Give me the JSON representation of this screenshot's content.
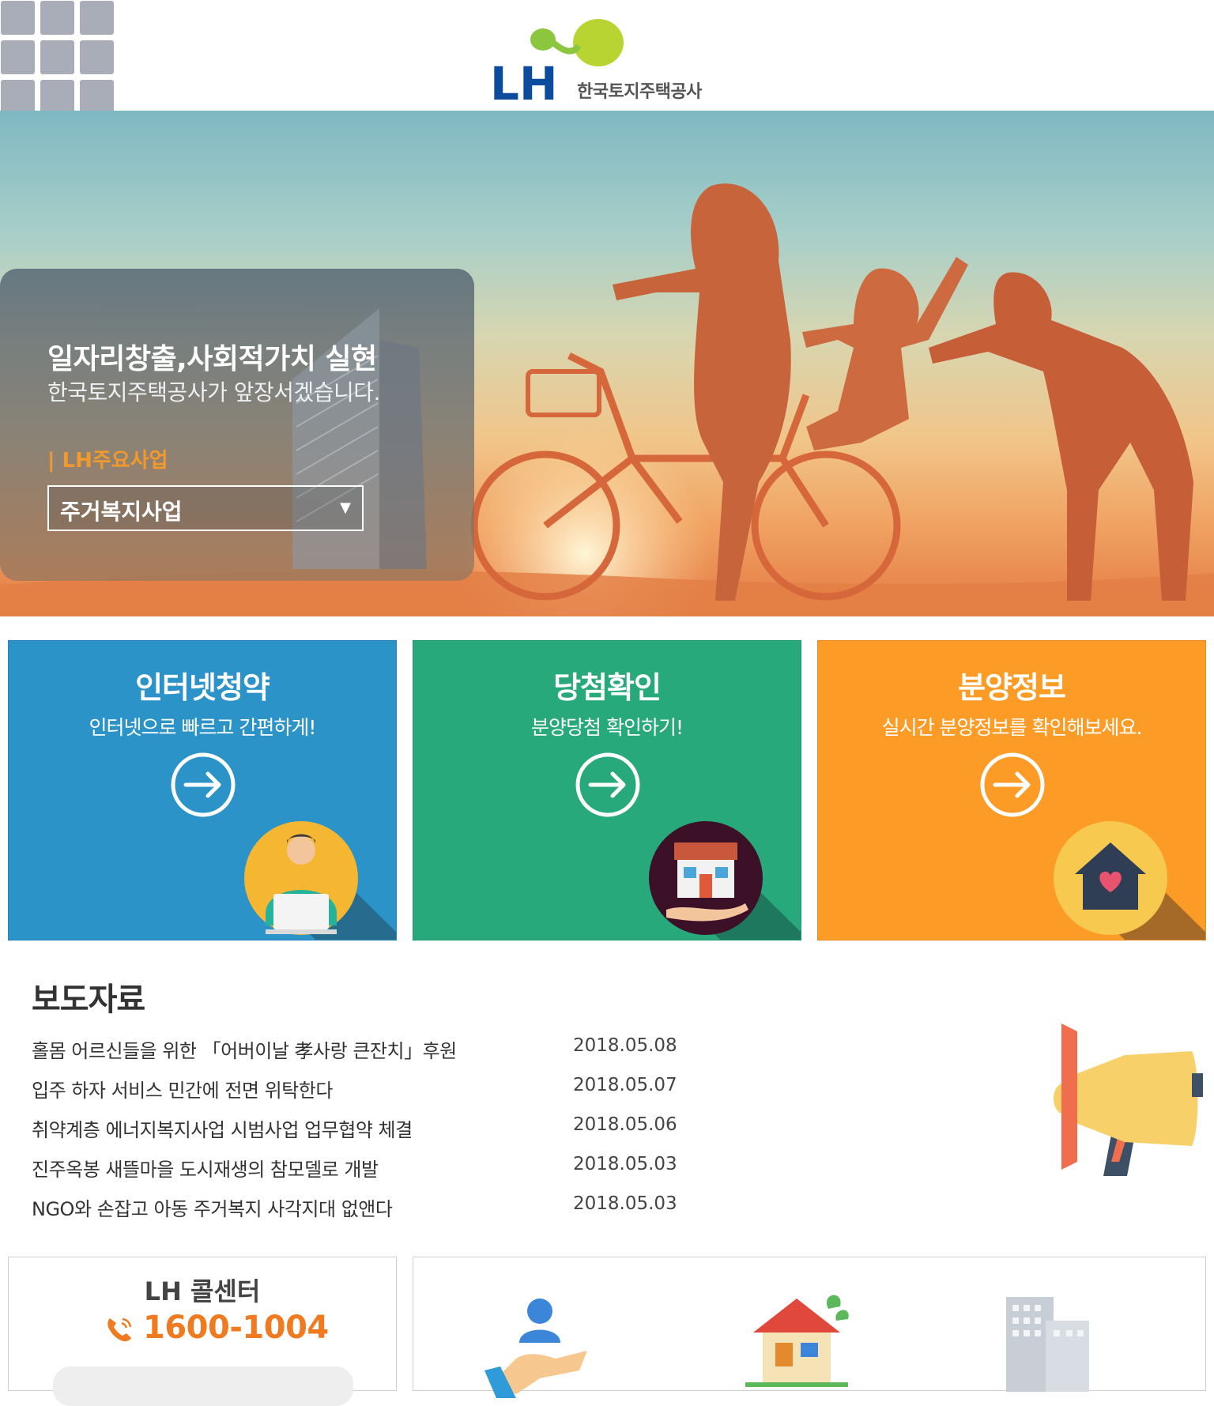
{
  "header": {
    "logo_letters": "LH",
    "logo_caption": "한국토지주택공사",
    "menu_icon": "grid-menu-icon"
  },
  "hero": {
    "title": "일자리창출,사회적가치 실현",
    "subtitle": "한국토지주택공사가 앞장서겠습니다.",
    "business_label": "| LH주요사업",
    "select_value": "주거복지사업"
  },
  "cards": [
    {
      "title": "인터넷청약",
      "desc": "인터넷으로 빠르고 간편하게!",
      "icon": "person-laptop-icon",
      "color": "#2c93c9"
    },
    {
      "title": "당첨확인",
      "desc": "분양당첨 확인하기!",
      "icon": "house-hand-icon",
      "color": "#27a97c"
    },
    {
      "title": "분양정보",
      "desc": "실시간 분양정보를 확인해보세요.",
      "icon": "heart-house-icon",
      "color": "#fc9c27"
    }
  ],
  "news": {
    "title": "보도자료",
    "items": [
      {
        "title": "홀몸 어르신들을 위한 「어버이날 孝사랑 큰잔치」후원",
        "date": "2018.05.08"
      },
      {
        "title": "입주 하자 서비스 민간에 전면 위탁한다",
        "date": "2018.05.07"
      },
      {
        "title": "취약계층 에너지복지사업 시범사업 업무협약 체결",
        "date": "2018.05.06"
      },
      {
        "title": "진주옥봉 새뜰마을 도시재생의 참모델로 개발",
        "date": "2018.05.03"
      },
      {
        "title": "NGO와 손잡고 아동 주거복지 사각지대 없앤다",
        "date": "2018.05.03"
      }
    ],
    "icon": "megaphone-icon"
  },
  "call_center": {
    "title": "LH 콜센터",
    "number": "1600-1004"
  },
  "colors": {
    "blue": "#2c93c9",
    "green": "#27a97c",
    "orange": "#fc9c27",
    "accent": "#f07a1f"
  }
}
